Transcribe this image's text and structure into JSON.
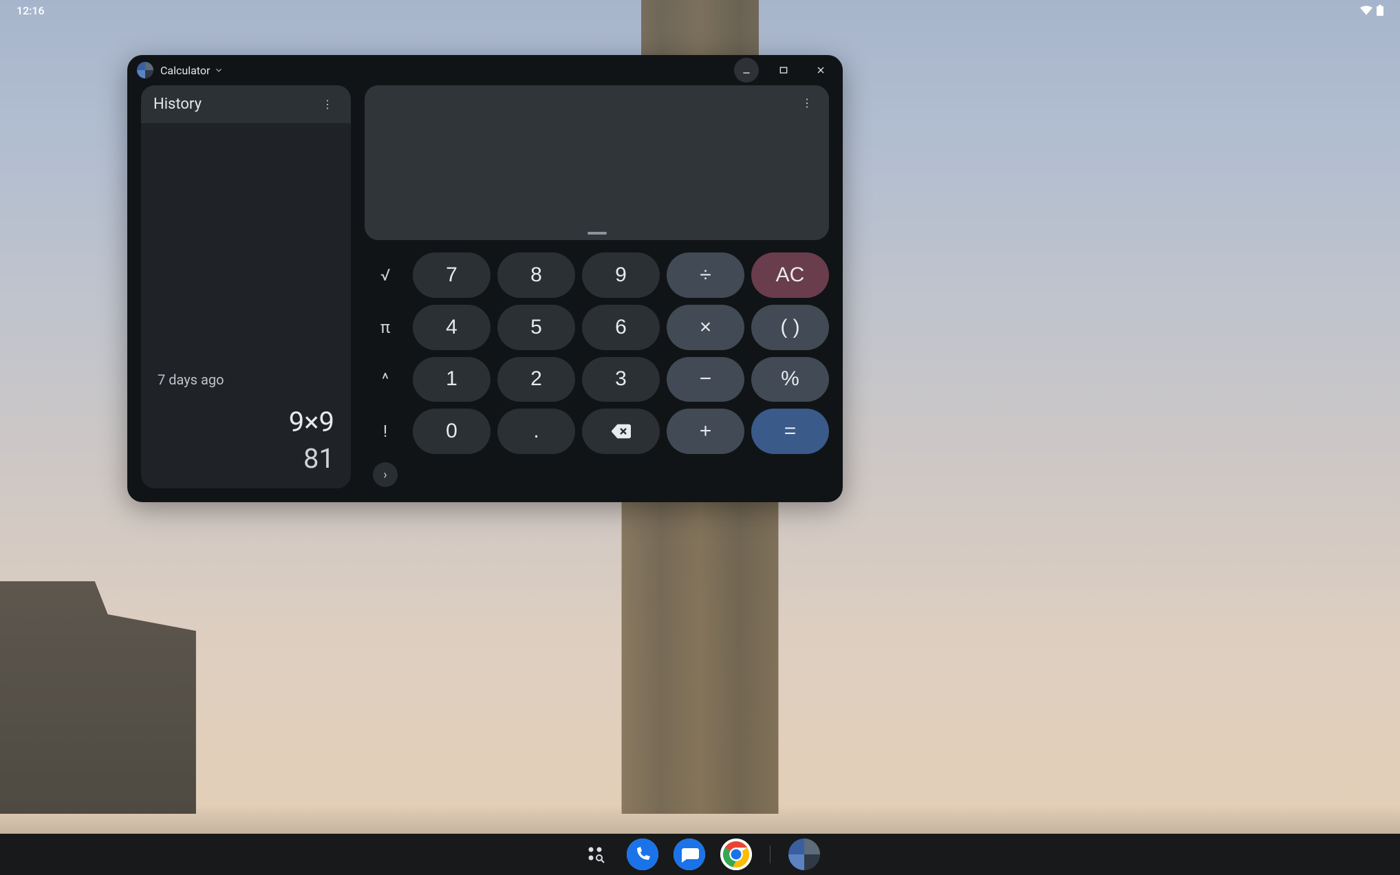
{
  "status": {
    "time": "12:16"
  },
  "window": {
    "title": "Calculator"
  },
  "history": {
    "title": "History",
    "age_label": "7 days ago",
    "expression": "9×9",
    "result": "81"
  },
  "display": {
    "value": ""
  },
  "scientific": {
    "sqrt": "√",
    "pi": "π",
    "power": "^",
    "factorial": "!",
    "expand": "›"
  },
  "keys": {
    "n0": "0",
    "n1": "1",
    "n2": "2",
    "n3": "3",
    "n4": "4",
    "n5": "5",
    "n6": "6",
    "n7": "7",
    "n8": "8",
    "n9": "9",
    "dot": ".",
    "div": "÷",
    "mul": "×",
    "sub": "−",
    "add": "+",
    "ac": "AC",
    "paren": "( )",
    "pct": "%",
    "eq": "="
  },
  "taskbar": {
    "apps": [
      "launcher",
      "phone",
      "messages",
      "chrome",
      "calculator"
    ]
  }
}
